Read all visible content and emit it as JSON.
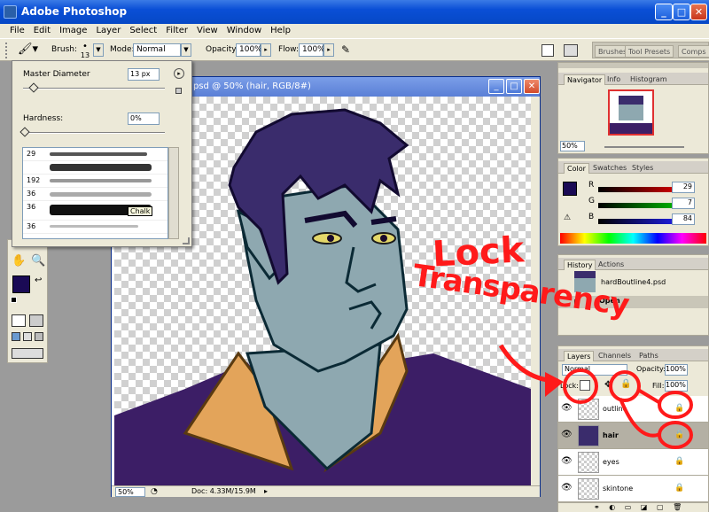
{
  "titlebar": {
    "title": "Adobe Photoshop"
  },
  "menu": [
    "File",
    "Edit",
    "Image",
    "Layer",
    "Select",
    "Filter",
    "View",
    "Window",
    "Help"
  ],
  "options": {
    "brush_label": "Brush:",
    "brush_size": "13",
    "mode_label": "Mode:",
    "mode_value": "Normal",
    "opacity_label": "Opacity:",
    "opacity_value": "100%",
    "flow_label": "Flow:",
    "flow_value": "100%"
  },
  "palette_well": {
    "tabs": [
      "Brushes",
      "Tool Presets",
      "Comps"
    ]
  },
  "brush_popup": {
    "master_diameter_label": "Master Diameter",
    "master_diameter_value": "13 px",
    "hardness_label": "Hardness:",
    "hardness_value": "0%",
    "tooltip": "Chalk",
    "brushes": [
      {
        "num": "29",
        "stroke": "spatter"
      },
      {
        "num": "",
        "stroke": "soft"
      },
      {
        "num": "192",
        "stroke": "hard"
      },
      {
        "num": "36",
        "stroke": "spatter"
      },
      {
        "num": "36",
        "stroke": "chalk"
      },
      {
        "num": "36",
        "stroke": "spatter"
      }
    ]
  },
  "document": {
    "title": "psd @ 50% (hair, RGB/8#)",
    "zoom": "50%",
    "doc_size": "Doc: 4.33M/15.9M"
  },
  "navigator": {
    "tabs": [
      "Navigator",
      "Info",
      "Histogram"
    ],
    "zoom": "50%"
  },
  "color": {
    "tabs": [
      "Color",
      "Swatches",
      "Styles"
    ],
    "foreground": "#1a0a55",
    "r_label": "R",
    "r_value": "29",
    "g_label": "G",
    "g_value": "7",
    "b_label": "B",
    "b_value": "84"
  },
  "history": {
    "tabs": [
      "History",
      "Actions"
    ],
    "items": [
      "hardBoutline4.psd",
      "Open"
    ]
  },
  "layers": {
    "tabs": [
      "Layers",
      "Channels",
      "Paths"
    ],
    "blend_mode": "Normal",
    "opacity_label": "Opacity:",
    "opacity_value": "100%",
    "lock_label": "Lock:",
    "fill_label": "Fill:",
    "fill_value": "100%",
    "items": [
      {
        "name": "outline"
      },
      {
        "name": "hair"
      },
      {
        "name": "eyes"
      },
      {
        "name": "skintone"
      }
    ]
  },
  "annotation": {
    "line1": "Lock",
    "line2": "Transparency"
  },
  "colors": {
    "skin": "#8ea8b0",
    "hair": "#3a2c6c",
    "shirt": "#3c1e66",
    "collar": "#e3a45a",
    "annotation": "#ff1a1a"
  }
}
